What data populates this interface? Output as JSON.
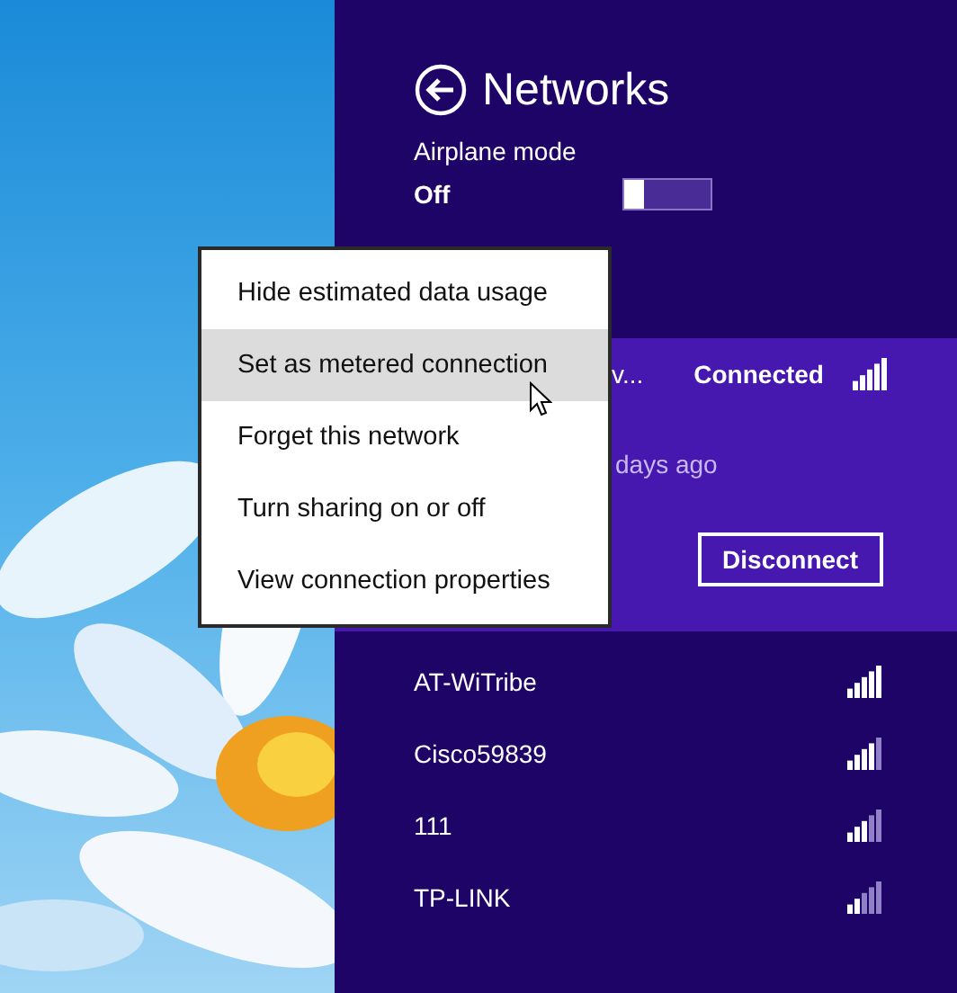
{
  "panel": {
    "title": "Networks",
    "airplane_mode": {
      "label": "Airplane mode",
      "state": "Off",
      "on": false
    }
  },
  "connected_network": {
    "name": "v...",
    "status": "Connected",
    "level": 1,
    "detail": "days ago",
    "button": "Disconnect"
  },
  "networks": [
    {
      "name": "AT-WiTribe",
      "level": 1
    },
    {
      "name": "Cisco59839",
      "level": 0.8
    },
    {
      "name": "111",
      "level": 0.6
    },
    {
      "name": "TP-LINK",
      "level": 0.4
    }
  ],
  "context_menu": [
    {
      "label": "Hide estimated data usage",
      "selected": false
    },
    {
      "label": "Set as metered connection",
      "selected": true
    },
    {
      "label": "Forget this network",
      "selected": false
    },
    {
      "label": "Turn sharing on or off",
      "selected": false
    },
    {
      "label": "View connection properties",
      "selected": false
    }
  ]
}
